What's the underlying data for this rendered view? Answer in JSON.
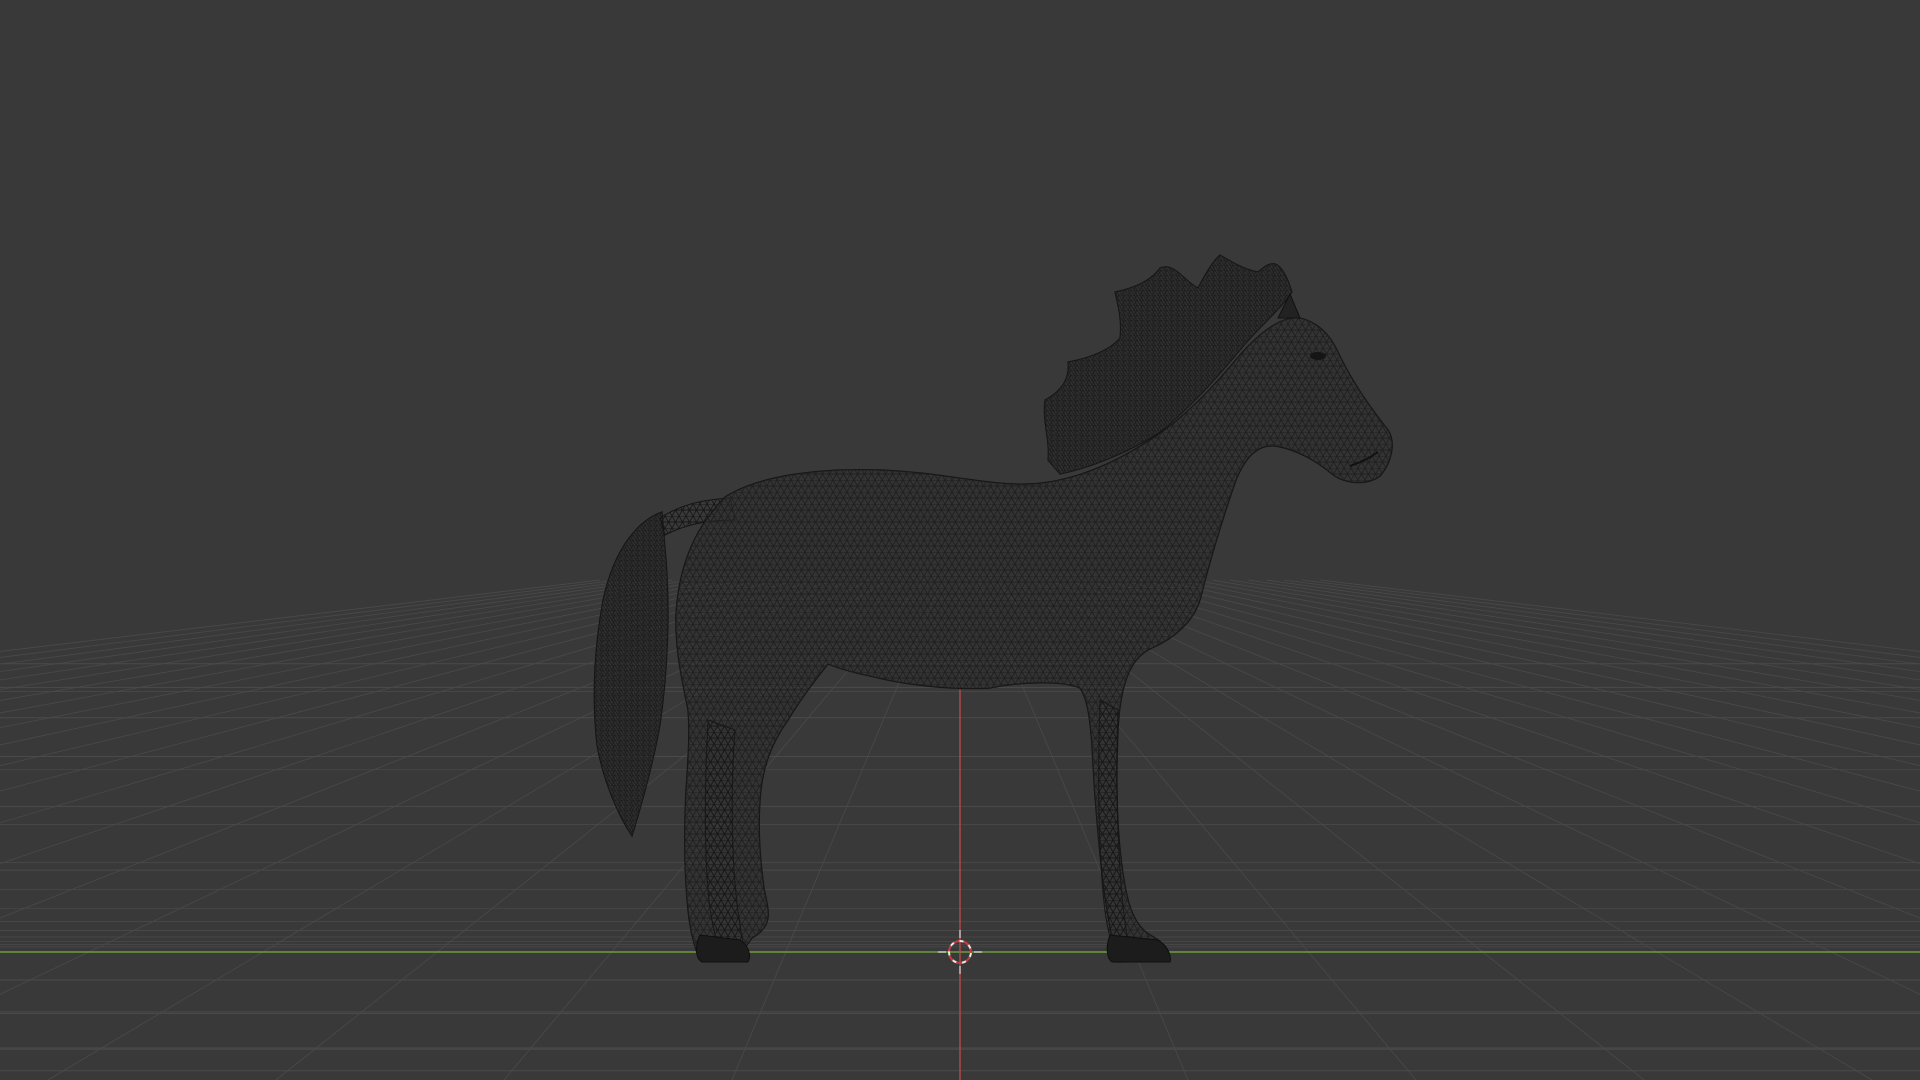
{
  "viewport": {
    "mode": "wireframe",
    "object": "horse",
    "background_color": "#393939",
    "grid_color": "#4a4a4a",
    "x_axis_color": "#6f9e3a",
    "z_axis_color": "#c24a4a",
    "mesh_line_color": "#141414",
    "mesh_fill_color": "#2f2f2f"
  }
}
